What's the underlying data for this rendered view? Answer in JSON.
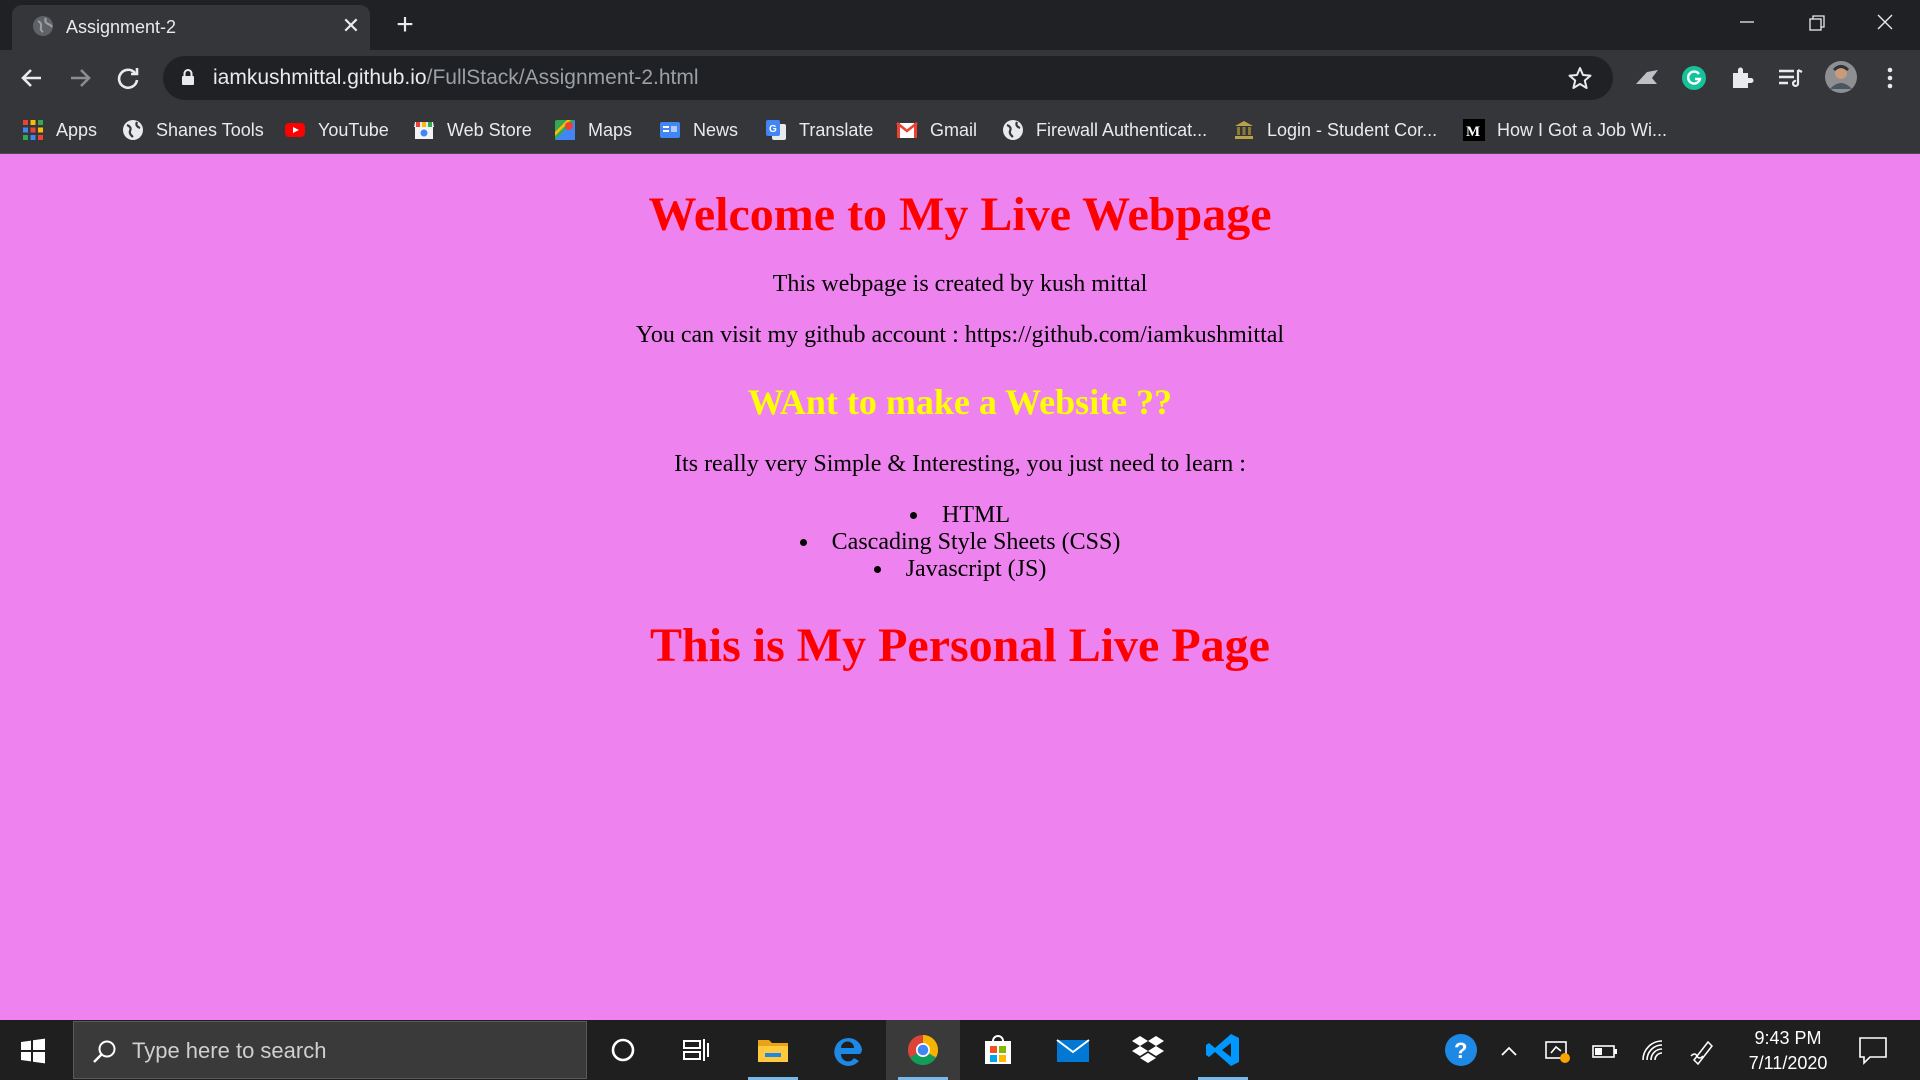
{
  "browser": {
    "tab": {
      "title": "Assignment-2"
    },
    "address": {
      "host": "iamkushmittal.github.io",
      "path": "/FullStack/Assignment-2.html"
    },
    "bookmarks": [
      {
        "label": "Apps"
      },
      {
        "label": "Shanes Tools"
      },
      {
        "label": "YouTube"
      },
      {
        "label": "Web Store"
      },
      {
        "label": "Maps"
      },
      {
        "label": "News"
      },
      {
        "label": "Translate"
      },
      {
        "label": "Gmail"
      },
      {
        "label": "Firewall Authenticat..."
      },
      {
        "label": "Login - Student Cor..."
      },
      {
        "label": "How I Got a Job Wi..."
      }
    ]
  },
  "page": {
    "heading": "Welcome to My Live Webpage",
    "created_by": "This webpage is created by kush mittal",
    "github_line": "You can visit my github account : https://github.com/iamkushmittal",
    "subheading": "WAnt to make a Website ??",
    "intro": "Its really very Simple & Interesting, you just need to learn :",
    "topics": [
      "HTML",
      "Cascading Style Sheets (CSS)",
      "Javascript (JS)"
    ],
    "footer_heading": "This is My Personal Live Page",
    "background_color": "#ee82ee",
    "heading_color": "#ff0000",
    "subheading_color": "#ffff00"
  },
  "taskbar": {
    "search_placeholder": "Type here to search",
    "time": "9:43 PM",
    "date": "7/11/2020"
  }
}
